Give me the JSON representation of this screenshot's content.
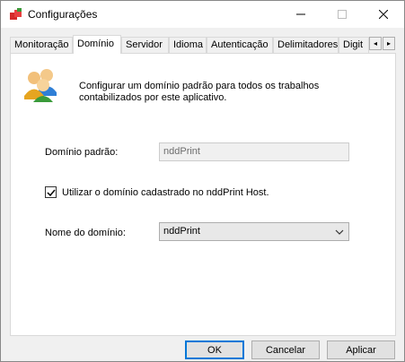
{
  "window": {
    "title": "Configurações",
    "icon": "app-cube-icon",
    "controls": {
      "minimize": "minimize-icon",
      "maximize": "maximize-icon",
      "close": "close-icon"
    }
  },
  "tabs": [
    {
      "label": "Monitoração",
      "active": false
    },
    {
      "label": "Domínio",
      "active": true
    },
    {
      "label": "Servidor",
      "active": false
    },
    {
      "label": "Idioma",
      "active": false
    },
    {
      "label": "Autenticação",
      "active": false
    },
    {
      "label": "Delimitadores",
      "active": false
    },
    {
      "label": "Digit",
      "active": false
    }
  ],
  "tab_scroll": {
    "left": "◂",
    "right": "▸"
  },
  "panel": {
    "icon": "users-icon",
    "description": "Configurar um domínio padrão para todos os trabalhos contabilizados por este aplicativo.",
    "default_domain_label": "Domínio padrão:",
    "default_domain_value": "nddPrint",
    "use_host_label": "Utilizar o domínio cadastrado no nddPrint Host.",
    "use_host_checked": true,
    "domain_name_label": "Nome do domínio:",
    "domain_name_value": "nddPrint"
  },
  "buttons": {
    "ok": "OK",
    "cancel": "Cancelar",
    "apply": "Aplicar"
  }
}
